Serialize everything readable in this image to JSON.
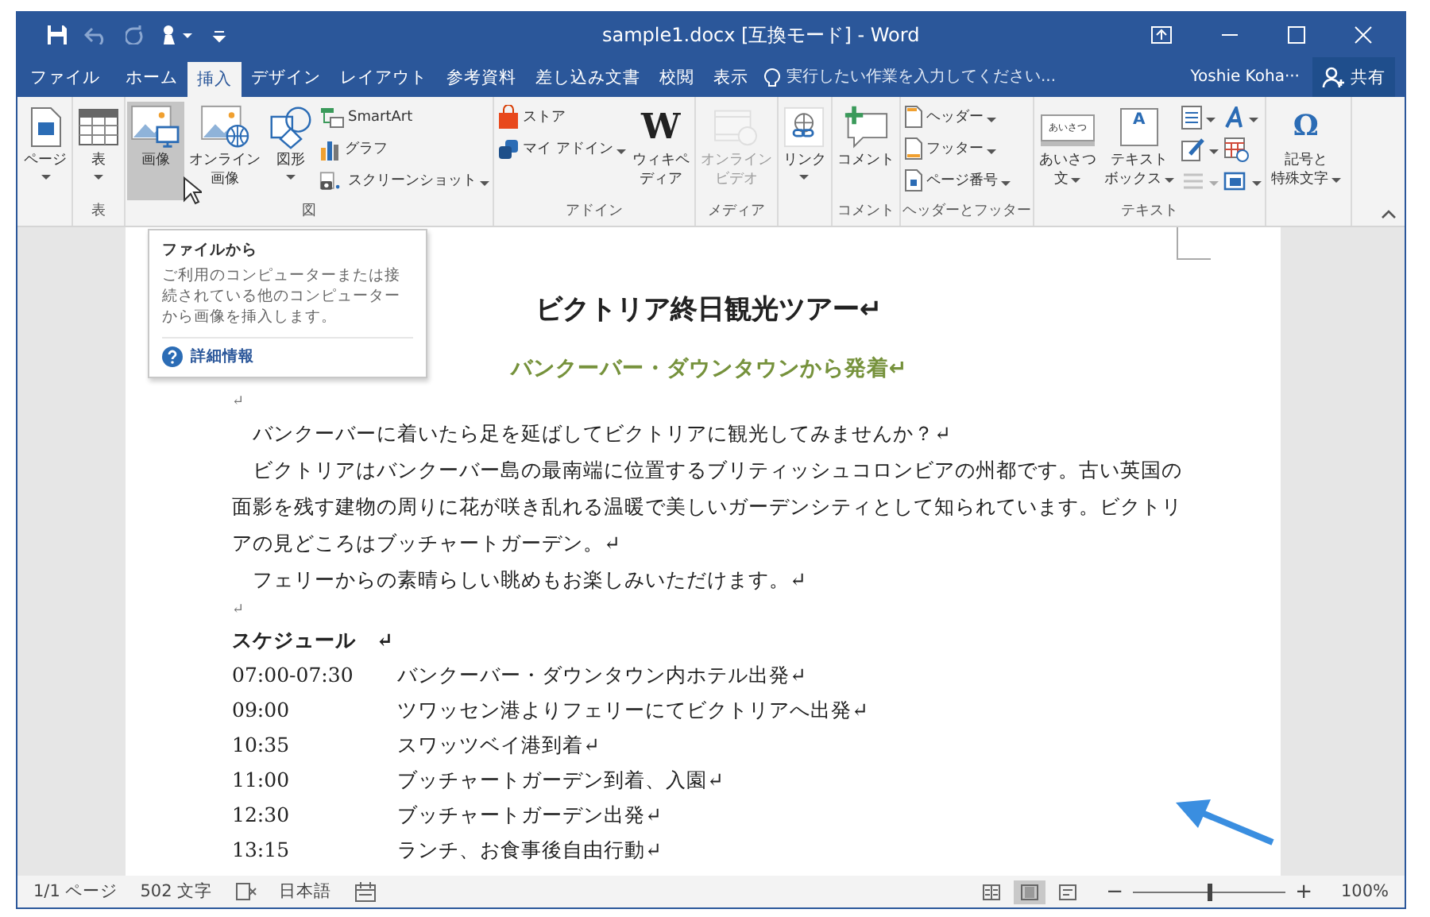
{
  "window": {
    "title": "sample1.docx [互換モード] - Word"
  },
  "tabs": [
    {
      "label": "ファイル",
      "selected": false
    },
    {
      "label": "ホーム",
      "selected": false
    },
    {
      "label": "挿入",
      "selected": true
    },
    {
      "label": "デザイン",
      "selected": false
    },
    {
      "label": "レイアウト",
      "selected": false
    },
    {
      "label": "参考資料",
      "selected": false
    },
    {
      "label": "差し込み文書",
      "selected": false
    },
    {
      "label": "校閲",
      "selected": false
    },
    {
      "label": "表示",
      "selected": false
    }
  ],
  "tell_me": {
    "placeholder": "実行したい作業を入力してください..."
  },
  "user": "Yoshie Koha···",
  "share": "共有",
  "ribbon_groups": [
    {
      "items": [
        {
          "kind": "large",
          "lines": [
            "ページ"
          ],
          "dropdown": true,
          "hovered": false,
          "disabled": false
        }
      ]
    },
    {
      "label": "表",
      "items": [
        {
          "kind": "large",
          "lines": [
            "表"
          ],
          "dropdown": true,
          "hovered": false,
          "disabled": false
        }
      ]
    },
    {
      "label": "図",
      "items": [
        {
          "kind": "large",
          "lines": [
            "画像"
          ],
          "dropdown": false,
          "hovered": true,
          "disabled": false
        },
        {
          "kind": "large",
          "lines": [
            "オンライン",
            "画像"
          ],
          "dropdown": false,
          "hovered": false,
          "disabled": false
        },
        {
          "kind": "large",
          "lines": [
            "図形"
          ],
          "dropdown": true,
          "hovered": false,
          "disabled": false
        },
        {
          "kind": "small",
          "label": "SmartArt",
          "dropdown": false,
          "hovered": false,
          "disabled": false
        },
        {
          "kind": "small",
          "label": "グラフ",
          "dropdown": false,
          "hovered": false,
          "disabled": false
        },
        {
          "kind": "small",
          "label": "スクリーンショット",
          "dropdown": true,
          "hovered": false,
          "disabled": false
        }
      ]
    },
    {
      "label": "アドイン",
      "items": [
        {
          "kind": "small",
          "label": "ストア",
          "dropdown": false,
          "hovered": false,
          "disabled": false
        },
        {
          "kind": "small",
          "label": "マイ アドイン",
          "dropdown": true,
          "hovered": false,
          "disabled": false
        },
        {
          "kind": "large",
          "icon_text": "W",
          "lines": [
            "ウィキペ",
            "ディア"
          ],
          "dropdown": false,
          "hovered": false,
          "disabled": false
        }
      ]
    },
    {
      "label": "メディア",
      "items": [
        {
          "kind": "large",
          "lines": [
            "オンライン",
            "ビデオ"
          ],
          "dropdown": false,
          "hovered": false,
          "disabled": true
        }
      ]
    },
    {
      "items": [
        {
          "kind": "large",
          "lines": [
            "リンク"
          ],
          "dropdown": true,
          "hovered": false,
          "disabled": false
        }
      ]
    },
    {
      "label": "コメント",
      "items": [
        {
          "kind": "large",
          "lines": [
            "コメント"
          ],
          "dropdown": false,
          "hovered": false,
          "disabled": false
        }
      ]
    },
    {
      "label": "ヘッダーとフッター",
      "items": [
        {
          "kind": "small",
          "label": "ヘッダー",
          "dropdown": true,
          "hovered": false,
          "disabled": false
        },
        {
          "kind": "small",
          "label": "フッター",
          "dropdown": true,
          "hovered": false,
          "disabled": false
        },
        {
          "kind": "small",
          "label": "ページ番号",
          "dropdown": true,
          "hovered": false,
          "disabled": false
        }
      ]
    },
    {
      "label": "テキスト",
      "items": [
        {
          "kind": "large",
          "icon_text": "あいさつ",
          "lines": [
            "あいさつ",
            "文"
          ],
          "dropdown": true,
          "hovered": false,
          "disabled": false
        },
        {
          "kind": "large",
          "icon_text": "A",
          "lines": [
            "テキスト",
            "ボックス"
          ],
          "dropdown": true,
          "hovered": false,
          "disabled": false
        },
        {
          "kind": "small",
          "dropdown": true,
          "hovered": false,
          "disabled": false
        },
        {
          "kind": "small",
          "dropdown": true,
          "hovered": false,
          "disabled": false
        },
        {
          "kind": "small",
          "dropdown": true,
          "hovered": false,
          "disabled": true
        },
        {
          "kind": "small",
          "dropdown": true,
          "hovered": false,
          "disabled": false
        },
        {
          "kind": "small",
          "dropdown": false,
          "hovered": false,
          "disabled": false
        },
        {
          "kind": "small",
          "dropdown": true,
          "hovered": false,
          "disabled": false
        }
      ]
    },
    {
      "items": [
        {
          "kind": "large",
          "icon_text": "Ω",
          "lines": [
            "記号と",
            "特殊文字"
          ],
          "dropdown": true,
          "hovered": false,
          "disabled": false
        }
      ]
    }
  ],
  "tooltip": {
    "title": "ファイルから",
    "body": "ご利用のコンピューターまたは接続されている他のコンピューターから画像を挿入します。",
    "link": "詳細情報"
  },
  "document": {
    "title": "ビクトリア終日観光ツアー↵",
    "subtitle": "バンクーバー・ダウンタウンから発着↵",
    "blank_mark": "↵",
    "paragraphs": [
      "　バンクーバーに着いたら足を延ばしてビクトリアに観光してみませんか？↵",
      "　ビクトリアはバンクーバー島の最南端に位置するブリティッシュコロンビアの州都です。古い英国の面影を残す建物の周りに花が咲き乱れる温暖で美しいガーデンシティとして知られています。ビクトリアの見どころはブッチャートガーデン。↵",
      "　フェリーからの素晴らしい眺めもお楽しみいただけます。↵"
    ],
    "blank_mark_2": "↵",
    "schedule_heading": "スケジュール　↵",
    "schedule": [
      {
        "time": "07:00-07:30",
        "text": "バンクーバー・ダウンタウン内ホテル出発↵"
      },
      {
        "time": "09:00",
        "text": "ツワッセン港よりフェリーにてビクトリアへ出発↵"
      },
      {
        "time": "10:35",
        "text": "スワッツベイ港到着↵"
      },
      {
        "time": "11:00",
        "text": "ブッチャートガーデン到着、入園↵"
      },
      {
        "time": "12:30",
        "text": "ブッチャートガーデン出発↵"
      },
      {
        "time": "13:15",
        "text": "ランチ、お食事後自由行動↵"
      }
    ]
  },
  "status_bar": {
    "page": "1/1 ページ",
    "words": "502 文字",
    "language": "日本語",
    "views": [
      {
        "selected": false
      },
      {
        "selected": true
      },
      {
        "selected": false
      }
    ],
    "zoom_out": "−",
    "zoom_in": "+",
    "zoom": {
      "level": 0.5
    },
    "zoom_label": "100%"
  }
}
